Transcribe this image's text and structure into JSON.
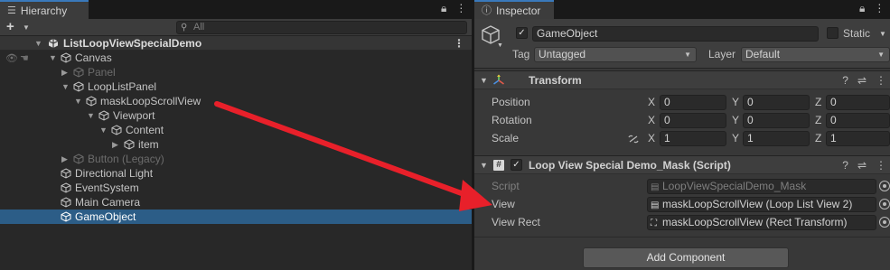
{
  "hierarchy": {
    "tab_label": "Hierarchy",
    "add_label": "+",
    "search_placeholder": "All",
    "scene_name": "ListLoopViewSpecialDemo",
    "kebab": "⋮",
    "items": [
      {
        "label": "Canvas"
      },
      {
        "label": "Panel"
      },
      {
        "label": "LoopListPanel"
      },
      {
        "label": "maskLoopScrollView"
      },
      {
        "label": "Viewport"
      },
      {
        "label": "Content"
      },
      {
        "label": "item"
      },
      {
        "label": "Button (Legacy)"
      },
      {
        "label": "Directional Light"
      },
      {
        "label": "EventSystem"
      },
      {
        "label": "Main Camera"
      },
      {
        "label": "GameObject"
      }
    ]
  },
  "inspector": {
    "tab_label": "Inspector",
    "gameobject": {
      "name": "GameObject",
      "static_label": "Static",
      "tag_label": "Tag",
      "tag_value": "Untagged",
      "layer_label": "Layer",
      "layer_value": "Default"
    },
    "transform": {
      "title": "Transform",
      "rows": [
        {
          "label": "Position",
          "x": "0",
          "y": "0",
          "z": "0"
        },
        {
          "label": "Rotation",
          "x": "0",
          "y": "0",
          "z": "0"
        },
        {
          "label": "Scale",
          "x": "1",
          "y": "1",
          "z": "1"
        }
      ],
      "axis_x": "X",
      "axis_y": "Y",
      "axis_z": "Z"
    },
    "script_component": {
      "title": "Loop View Special Demo_Mask (Script)",
      "script_label": "Script",
      "script_value": "LoopViewSpecialDemo_Mask",
      "view_label": "View",
      "view_value": "maskLoopScrollView (Loop List View 2)",
      "view_rect_label": "View Rect",
      "view_rect_value": "maskLoopScrollView (Rect Transform)"
    },
    "add_component_label": "Add Component"
  },
  "colors": {
    "selection": "#2c5d87",
    "accent_tab": "#3a79bb",
    "annotation_arrow": "#e8202a"
  }
}
